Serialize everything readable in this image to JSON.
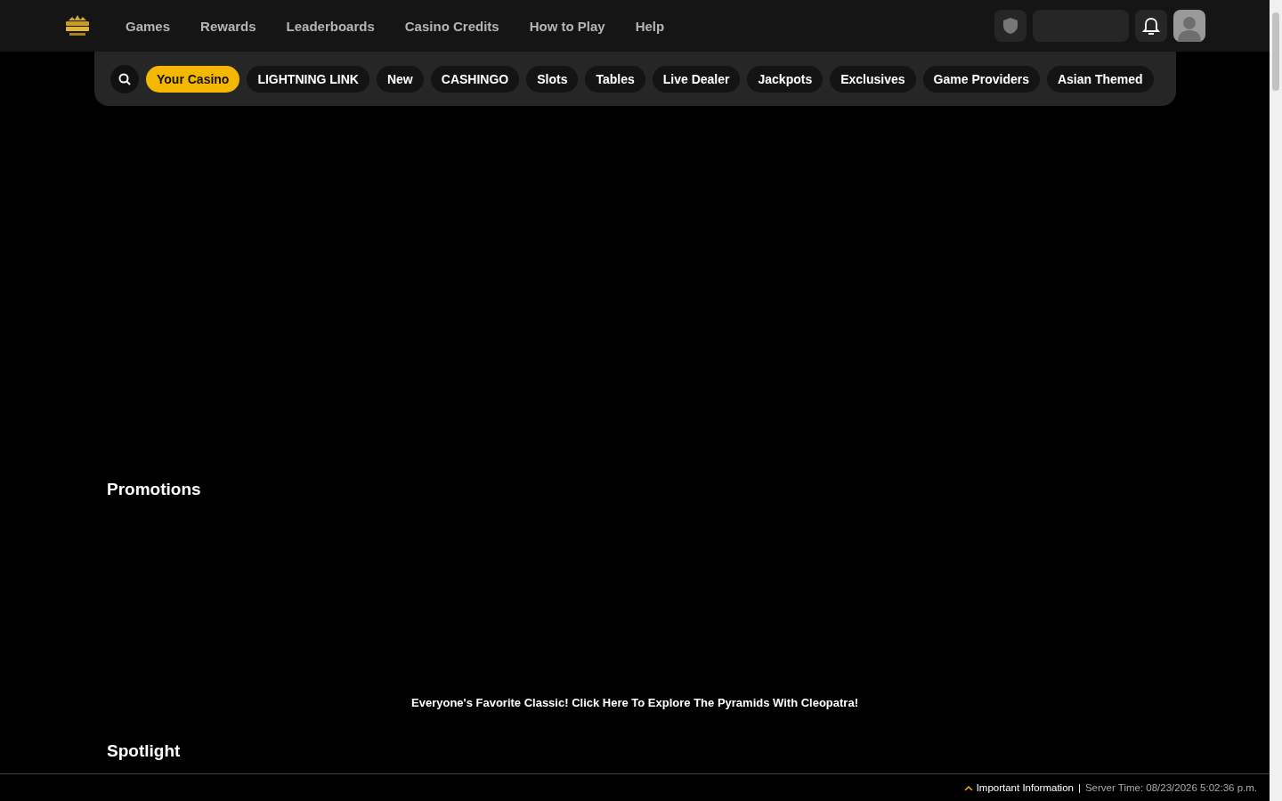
{
  "nav": [
    "Games",
    "Rewards",
    "Leaderboards",
    "Casino Credits",
    "How to Play",
    "Help"
  ],
  "categories": [
    {
      "label": "Your Casino",
      "selected": true
    },
    {
      "label": "LIGHTNING LINK",
      "selected": false
    },
    {
      "label": "New",
      "selected": false
    },
    {
      "label": "CASHINGO",
      "selected": false
    },
    {
      "label": "Slots",
      "selected": false
    },
    {
      "label": "Tables",
      "selected": false
    },
    {
      "label": "Live Dealer",
      "selected": false
    },
    {
      "label": "Jackpots",
      "selected": false
    },
    {
      "label": "Exclusives",
      "selected": false
    },
    {
      "label": "Game Providers",
      "selected": false
    },
    {
      "label": "Asian Themed",
      "selected": false
    }
  ],
  "sections": [
    {
      "title": "Promotions"
    },
    {
      "title": "Spotlight"
    }
  ],
  "promo_caption": "Everyone's Favorite Classic! Click Here To Explore The Pyramids With Cleopatra!",
  "footer": {
    "info": "Important Information",
    "separator": "|",
    "server_time": "Server Time: 08/23/2026 5:02:36 p.m."
  }
}
